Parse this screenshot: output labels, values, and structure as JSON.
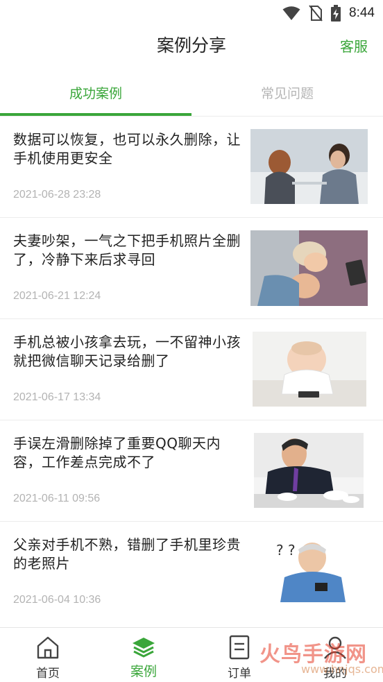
{
  "status_bar": {
    "time": "8:44",
    "icons": [
      "wifi-icon",
      "no-sim-icon",
      "battery-charging-icon"
    ]
  },
  "header": {
    "title": "案例分享",
    "action_label": "客服"
  },
  "tabs": [
    {
      "label": "成功案例",
      "active": true
    },
    {
      "label": "常见问题",
      "active": false
    }
  ],
  "cases": [
    {
      "title": "数据可以恢复，也可以永久删除，让手机使用更安全",
      "date": "2021-06-28 23:28",
      "image": "couple-arguing-photo"
    },
    {
      "title": "夫妻吵架，一气之下把手机照片全删了，冷静下来后求寻回",
      "date": "2021-06-21 12:24",
      "image": "couple-lying-photo"
    },
    {
      "title": "手机总被小孩拿去玩，一不留神小孩就把微信聊天记录给删了",
      "date": "2021-06-17 13:34",
      "image": "baby-phone-photo"
    },
    {
      "title": "手误左滑删除掉了重要QQ聊天内容，工作差点完成不了",
      "date": "2021-06-11 09:56",
      "image": "stressed-worker-photo"
    },
    {
      "title": "父亲对手机不熟，错删了手机里珍贵的老照片",
      "date": "2021-06-04 10:36",
      "image": "old-man-phone-photo"
    }
  ],
  "bottom_nav": [
    {
      "label": "首页",
      "icon": "home-icon",
      "active": false
    },
    {
      "label": "案例",
      "icon": "layers-icon",
      "active": true
    },
    {
      "label": "订单",
      "icon": "document-icon",
      "active": false
    },
    {
      "label": "我的",
      "icon": "user-icon",
      "active": false
    }
  ],
  "watermark": {
    "text": "火鸟手游网",
    "sub": "www.hnjqs.com"
  },
  "colors": {
    "accent": "#3aa63a",
    "muted_text": "#b3b3b3",
    "divider": "#ececec"
  }
}
